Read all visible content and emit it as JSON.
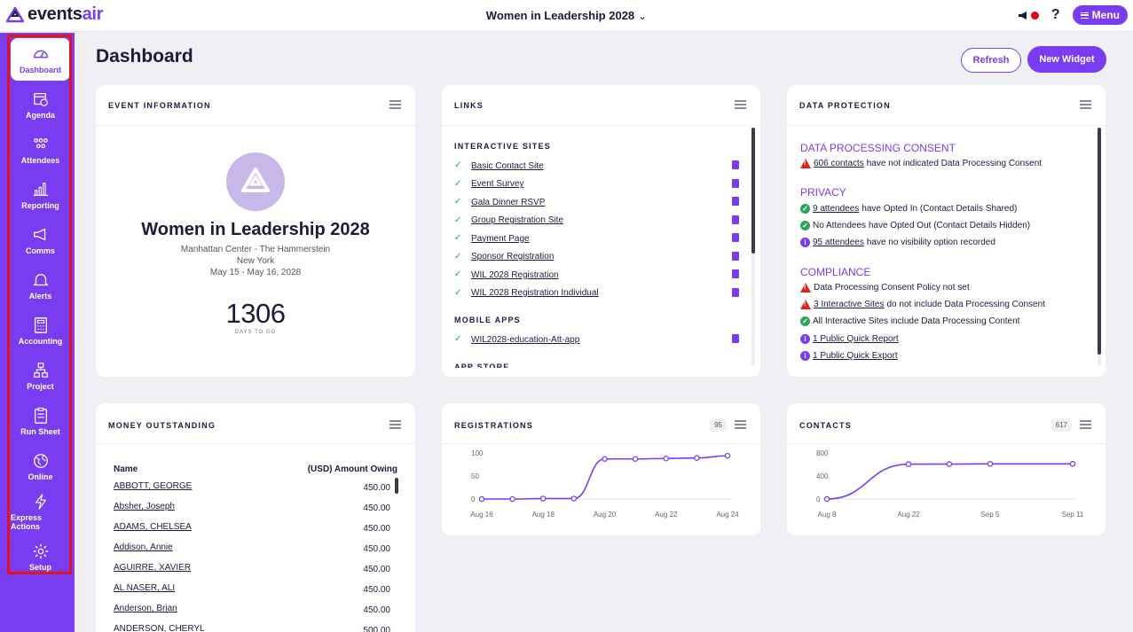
{
  "app": {
    "logo_text_a": "events",
    "logo_text_b": "air"
  },
  "header": {
    "event_title": "Women in Leadership 2028",
    "menu_label": "Menu",
    "help_label": "?"
  },
  "sidebar": {
    "items": [
      {
        "label": "Dashboard",
        "icon": "dashboard-icon"
      },
      {
        "label": "Agenda",
        "icon": "calendar-icon"
      },
      {
        "label": "Attendees",
        "icon": "people-icon"
      },
      {
        "label": "Reporting",
        "icon": "bar-chart-icon"
      },
      {
        "label": "Comms",
        "icon": "megaphone-icon"
      },
      {
        "label": "Alerts",
        "icon": "bell-icon"
      },
      {
        "label": "Accounting",
        "icon": "calculator-icon"
      },
      {
        "label": "Project",
        "icon": "hierarchy-icon"
      },
      {
        "label": "Run Sheet",
        "icon": "clipboard-icon"
      },
      {
        "label": "Online",
        "icon": "globe-icon"
      },
      {
        "label": "Express Actions",
        "icon": "lightning-icon"
      },
      {
        "label": "Setup",
        "icon": "gear-icon"
      }
    ]
  },
  "page": {
    "title": "Dashboard",
    "refresh_label": "Refresh",
    "new_widget_label": "New Widget"
  },
  "event_info": {
    "title": "EVENT INFORMATION",
    "name": "Women in Leadership 2028",
    "venue": "Manhattan Center - The Hammerstein",
    "city": "New York",
    "dates": "May 15 - May 16, 2028",
    "days_to_go": "1306",
    "days_label": "DAYS TO GO"
  },
  "links": {
    "title": "LINKS",
    "interactive_label": "INTERACTIVE SITES",
    "sites": [
      "Basic Contact Site",
      "Event Survey",
      "Gala Dinner RSVP",
      "Group Registration Site",
      "Payment Page",
      "Sponsor Registration",
      "WIL 2028 Registration",
      "WIL 2028 Registration Individual"
    ],
    "mobile_label": "MOBILE APPS",
    "apps": [
      "WIL2028-education-Att-app"
    ],
    "app_store_label": "APP STORE"
  },
  "data_protection": {
    "title": "DATA PROTECTION",
    "consent_head": "DATA PROCESSING CONSENT",
    "consent_link": "606 contacts",
    "consent_text": "have not indicated Data Processing Consent",
    "privacy_head": "PRIVACY",
    "privacy_1_link": "9 attendees",
    "privacy_1_text": "have Opted In (Contact Details Shared)",
    "privacy_2_text": "No Attendees have Opted Out (Contact Details Hidden)",
    "privacy_3_link": "95 attendees",
    "privacy_3_text": "have no visibility option recorded",
    "compliance_head": "COMPLIANCE",
    "comp_1_text": "Data Processing Consent Policy not set",
    "comp_2_link": "3 Interactive Sites",
    "comp_2_text": "do not include Data Processing Consent",
    "comp_3_text": "All Interactive Sites include Data Processing Content",
    "comp_4_link": "1 Public Quick Report",
    "comp_5_link": "1 Public Quick Export"
  },
  "money": {
    "title": "MONEY OUTSTANDING",
    "col_name": "Name",
    "col_amount": "(USD) Amount Owing",
    "rows": [
      {
        "name": "ABBOTT, GEORGE",
        "amount": "450.00"
      },
      {
        "name": "Absher, Joseph",
        "amount": "450.00"
      },
      {
        "name": "ADAMS, CHELSEA",
        "amount": "450.00"
      },
      {
        "name": "Addison, Annie",
        "amount": "450.00"
      },
      {
        "name": "AGUIRRE, XAVIER",
        "amount": "450.00"
      },
      {
        "name": "AL NASER, ALI",
        "amount": "450.00"
      },
      {
        "name": "Anderson, Brian",
        "amount": "450.00"
      },
      {
        "name": "ANDERSON, CHERYL",
        "amount": "500.00"
      }
    ]
  },
  "registrations": {
    "title": "REGISTRATIONS",
    "count": "95"
  },
  "contacts": {
    "title": "CONTACTS",
    "count": "617"
  },
  "chart_data": [
    {
      "type": "line",
      "title": "REGISTRATIONS",
      "x": [
        "Aug 16",
        "Aug 17",
        "Aug 18",
        "Aug 19",
        "Aug 20",
        "Aug 21",
        "Aug 22",
        "Aug 23",
        "Aug 24"
      ],
      "values": [
        0,
        0,
        1,
        1,
        87,
        87,
        88,
        89,
        94
      ],
      "xticks": [
        "Aug 16",
        "Aug 18",
        "Aug 20",
        "Aug 22",
        "Aug 24"
      ],
      "yticks": [
        0,
        50,
        100
      ],
      "ylim": [
        0,
        100
      ],
      "color": "#7a3cf0"
    },
    {
      "type": "line",
      "title": "CONTACTS",
      "x": [
        "Aug 8",
        "Aug 22",
        "Aug 29",
        "Sep 5",
        "Sep 11"
      ],
      "values": [
        0,
        605,
        607,
        610,
        611
      ],
      "xticks": [
        "Aug 8",
        "Aug 22",
        "Sep 5",
        "Sep 11"
      ],
      "yticks": [
        0,
        400,
        800
      ],
      "ylim": [
        0,
        800
      ],
      "color": "#7a3cf0"
    }
  ],
  "colors": {
    "brand": "#7a3cf0",
    "ok": "#2aa55a",
    "warn": "#d9261c",
    "highlight": "#e3131b"
  }
}
